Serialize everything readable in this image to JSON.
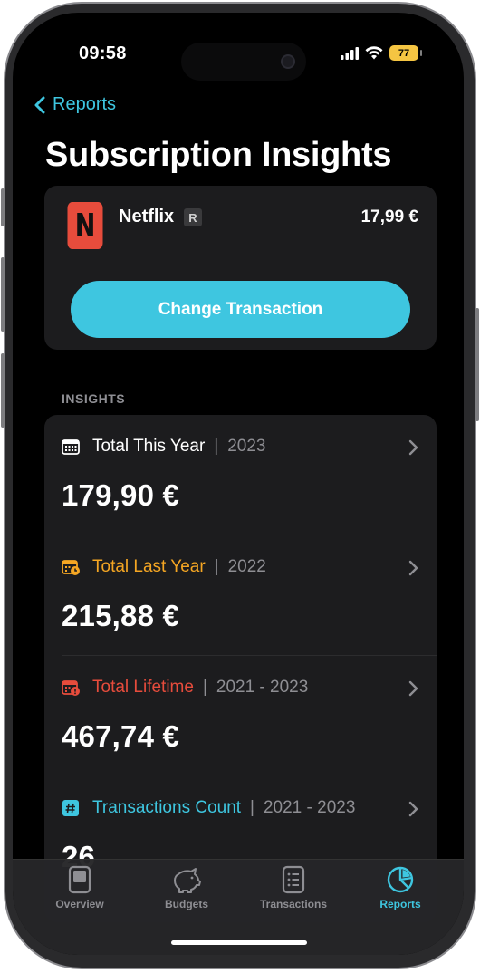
{
  "status_bar": {
    "time": "09:58",
    "battery": "77"
  },
  "nav": {
    "back_label": "Reports",
    "title": "Subscription Insights"
  },
  "subscription": {
    "name": "Netflix",
    "logo_letter": "N",
    "logo_color": "#e74c3c",
    "rating_badge": "R",
    "price": "17,99 €",
    "change_button": "Change Transaction"
  },
  "insights": {
    "section_label": "INSIGHTS",
    "rows": [
      {
        "icon": "calendar-icon",
        "title": "Total This Year",
        "title_color": "#ffffff",
        "period": "2023",
        "value": "179,90 €"
      },
      {
        "icon": "calendar-clock-icon",
        "title": "Total Last Year",
        "title_color": "#f5a623",
        "period": "2022",
        "value": "215,88 €"
      },
      {
        "icon": "calendar-alert-icon",
        "title": "Total Lifetime",
        "title_color": "#e74c3c",
        "period": "2021 - 2023",
        "value": "467,74 €"
      },
      {
        "icon": "hash-icon",
        "title": "Transactions Count",
        "title_color": "#3ec6e0",
        "period": "2021 - 2023",
        "value": "26"
      }
    ]
  },
  "tabbar": {
    "items": [
      {
        "label": "Overview",
        "icon": "overview-icon",
        "active": false
      },
      {
        "label": "Budgets",
        "icon": "piggy-bank-icon",
        "active": false
      },
      {
        "label": "Transactions",
        "icon": "receipt-icon",
        "active": false
      },
      {
        "label": "Reports",
        "icon": "pie-chart-icon",
        "active": true
      }
    ]
  },
  "colors": {
    "accent": "#3ec6e0",
    "card": "#1c1c1e",
    "background": "#000000"
  }
}
